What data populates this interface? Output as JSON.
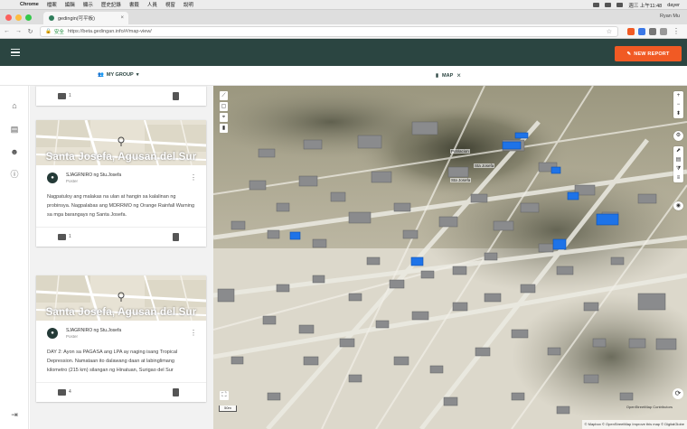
{
  "os_menubar": {
    "app": "Chrome",
    "items": [
      "檔案",
      "編輯",
      "顯示",
      "歷史記錄",
      "書籤",
      "人員",
      "視窗",
      "說明"
    ],
    "clock": "週三 上午11:48",
    "user": "dayer"
  },
  "browser": {
    "tab_title": "gedingin(可平板)",
    "profile": "Ryan Mu",
    "secure_label": "安全",
    "url": "https://beta.gedingan.info/#/map-view/"
  },
  "app": {
    "new_report_label": "NEW REPORT",
    "group_label": "MY GROUP",
    "map_tab_label": "MAP"
  },
  "feed": {
    "top_card": {
      "comments": "1"
    },
    "posts": [
      {
        "location": "Santa Josefa, Agusan del Sur",
        "author": "SJAGRNIRO ng Stu.Josefa",
        "role": "Poster",
        "text": "Nagpatuloy ang malakas na ulan at hangin sa kalalinan ng probinsya. Nagpalabas ang MDRRMO ng Orange Rainfall Warning sa mga barangays ng Santa Josefa.",
        "comments": "1"
      },
      {
        "location": "Santa Josefa, Agusan del Sur",
        "author": "SJAGRNIRO ng Stu.Josefa",
        "role": "Poster",
        "text": "DAY 2: Ayon sa PAGASA ang LPA ay naging isang Tropical Depression. Namataan ito dalawang daan at labinglimang kilometro (215 km) silangan ng Hinatuan, Surigao del Sur",
        "comments": "4"
      }
    ]
  },
  "map": {
    "labels": [
      "Poblacion",
      "Sta Josefa",
      "Sta Josefa"
    ],
    "scale": "50m",
    "attribution_1": "OpenStreetMap Contributors",
    "attribution_2": "© Mapbox © OpenStreetMap Improve this map © DigitalGlobe",
    "colors": {
      "building": "#7b7e82",
      "highlight": "#1e73e8",
      "appbar": "#2b4541",
      "accent": "#f15a24"
    }
  }
}
